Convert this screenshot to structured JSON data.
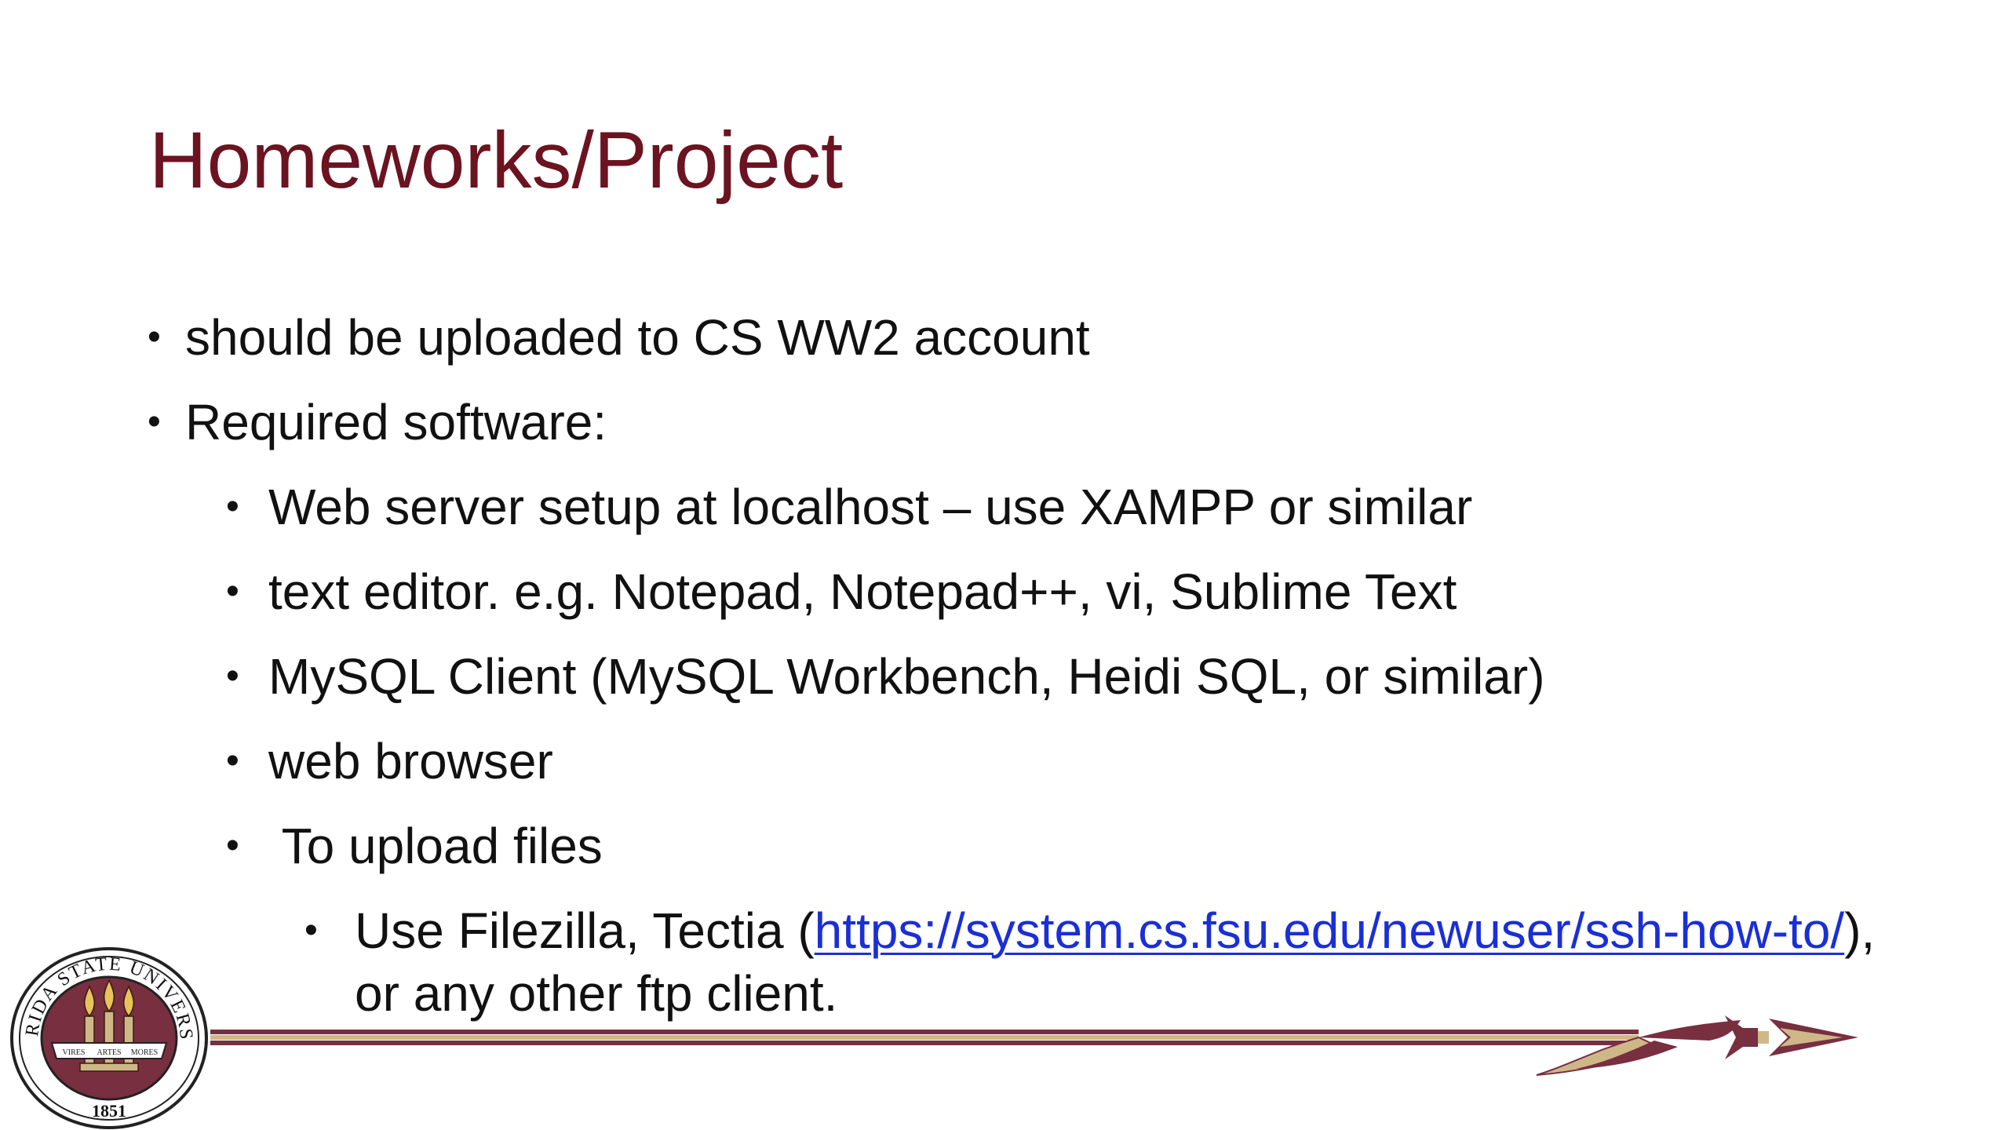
{
  "slide": {
    "title": "Homeworks/Project",
    "bullet_glyph": "•",
    "items": [
      {
        "level": 1,
        "text": "should be uploaded to CS WW2 account"
      },
      {
        "level": 1,
        "text": "Required software:"
      },
      {
        "level": 2,
        "text": "Web server setup at localhost – use XAMPP or similar"
      },
      {
        "level": 2,
        "text": "text editor. e.g. Notepad, Notepad++, vi, Sublime Text"
      },
      {
        "level": 2,
        "text": "MySQL Client (MySQL Workbench, Heidi SQL, or similar)"
      },
      {
        "level": 2,
        "text": "web browser"
      },
      {
        "level": 2,
        "text": " To upload files"
      },
      {
        "level": 3,
        "text_before": "Use Filezilla, Tectia (",
        "link": "https://system.cs.fsu.edu/newuser/ssh-how-to/",
        "text_after": "), or any other ftp client."
      }
    ]
  },
  "logo": {
    "seal_top_text": "FLORIDA STATE UNIVERSITY",
    "seal_year": "1851",
    "banner_left": "VIRES",
    "banner_mid": "ARTES",
    "banner_right": "MORES"
  },
  "colors": {
    "title": "#6b1320",
    "garnet": "#782f40",
    "gold": "#ceb888",
    "link": "#1a2fd6",
    "text": "#111111"
  }
}
